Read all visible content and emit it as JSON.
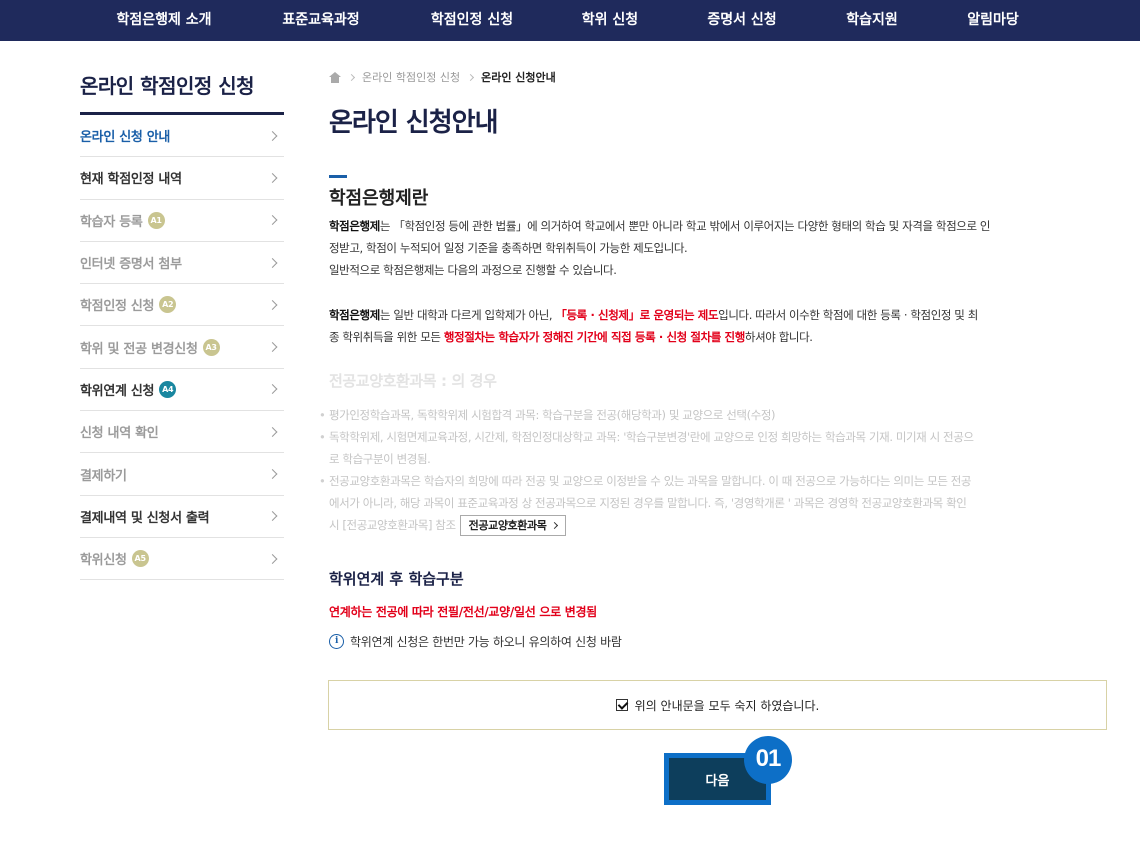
{
  "topnav": {
    "items": [
      {
        "label": "학점은행제 소개"
      },
      {
        "label": "표준교육과정"
      },
      {
        "label": "학점인정 신청"
      },
      {
        "label": "학위 신청"
      },
      {
        "label": "증명서 신청"
      },
      {
        "label": "학습지원"
      },
      {
        "label": "알림마당"
      }
    ]
  },
  "sidebar": {
    "title": "온라인 학점인정 신청",
    "items": [
      {
        "label": "온라인 신청 안내",
        "badge": ""
      },
      {
        "label": "현재 학점인정 내역",
        "badge": ""
      },
      {
        "label": "학습자 등록",
        "badge": "A1"
      },
      {
        "label": "인터넷 증명서 첨부",
        "badge": ""
      },
      {
        "label": "학점인정 신청",
        "badge": "A2"
      },
      {
        "label": "학위 및 전공 변경신청",
        "badge": "A3"
      },
      {
        "label": "학위연계 신청",
        "badge": "A4"
      },
      {
        "label": "신청 내역 확인",
        "badge": ""
      },
      {
        "label": "결제하기",
        "badge": ""
      },
      {
        "label": "결제내역 및 신청서 출력",
        "badge": ""
      },
      {
        "label": "학위신청",
        "badge": "A5"
      }
    ]
  },
  "breadcrumb": {
    "level1": "온라인 학점인정 신청",
    "level2": "온라인 신청안내"
  },
  "main": {
    "page_title": "온라인 신청안내",
    "section_title": "학점은행제란",
    "p1": {
      "l1_bold": "학점은행제",
      "l1_rest": "는 「학점인정 등에 관한 법률」에 의거하여 학교에서 뿐만 아니라 학교 밖에서 이루어지는 다양한 형태의 학습 및 자격을 학점으로 인",
      "l2": "정받고, 학점이 누적되어 일정 기준을 충족하면 학위취득이 가능한 제도입니다.",
      "l3": "일반적으로 학점은행제는 다음의 과정으로 진행할 수 있습니다."
    },
    "p2": {
      "l1_bold": "학점은행제",
      "l1_a": "는 일반 대학과 다르게 입학제가 아닌, ",
      "l1_red": "「등록 · 신청제」로 운영되는 제도",
      "l1_b": "입니다. 따라서 이수한 학점에 대한 등록 · 학점인정 및 최",
      "l2_a": "종 학위취득을 위한 모든 ",
      "l2_red": "행정절차는 학습자가 정해진 기간에 직접 등록 · 신청 절차를 진행",
      "l2_b": "하셔야 합니다."
    },
    "faded": {
      "title": "전공교양호환과목 : 의 경우",
      "b1": "평가인정학습과목, 독학학위제 시험합격 과목: 학습구분을 전공(해당학과) 및 교양으로 선택(수정)",
      "b2_l1": "독학학위제, 시험면제교육과정, 시간제, 학점인정대상학교 과목: '학습구분변경'란에 교양으로 인정 희망하는 학습과목 기재. 미기재 시 전공으",
      "b2_l2": "로 학습구분이 변경됨.",
      "b3_l1": "전공교양호환과목은 학습자의 희망에 따라 전공 및 교양으로 이정받을 수 있는 과목을 말합니다. 이 때 전공으로 가능하다는 의미는 모든 전공",
      "b3_l2": "에서가 아니라, 해당 과목이 표준교육과정 상 전공과목으로 지정된 경우를 말합니다. 즉, '경영학개론 ' 과목은 경영학 전공교양호환과목 확인",
      "b3_l3": "시 [전공교양호환과목] 참조",
      "ref_button": "전공교양호환과목"
    },
    "sub_title": "학위연계 후 학습구분",
    "red_notice": "연계하는 전공에 따라 전필/전선/교양/일선 으로 변경됨",
    "info_notice": "학위연계 신청은 한번만 가능 하오니 유의하여 신청 바람",
    "info_icon": "i",
    "agree_label": "위의 안내문을 모두 숙지 하였습니다.",
    "agree_checked": true,
    "next_button": "다음",
    "step_badge": "01"
  },
  "colors": {
    "nav_bg": "#1f2a5c",
    "accent_blue": "#0d6fc7",
    "button_dark": "#0d3e5c",
    "emphasis_red": "#e2001a",
    "active_link": "#1a5fa8"
  }
}
